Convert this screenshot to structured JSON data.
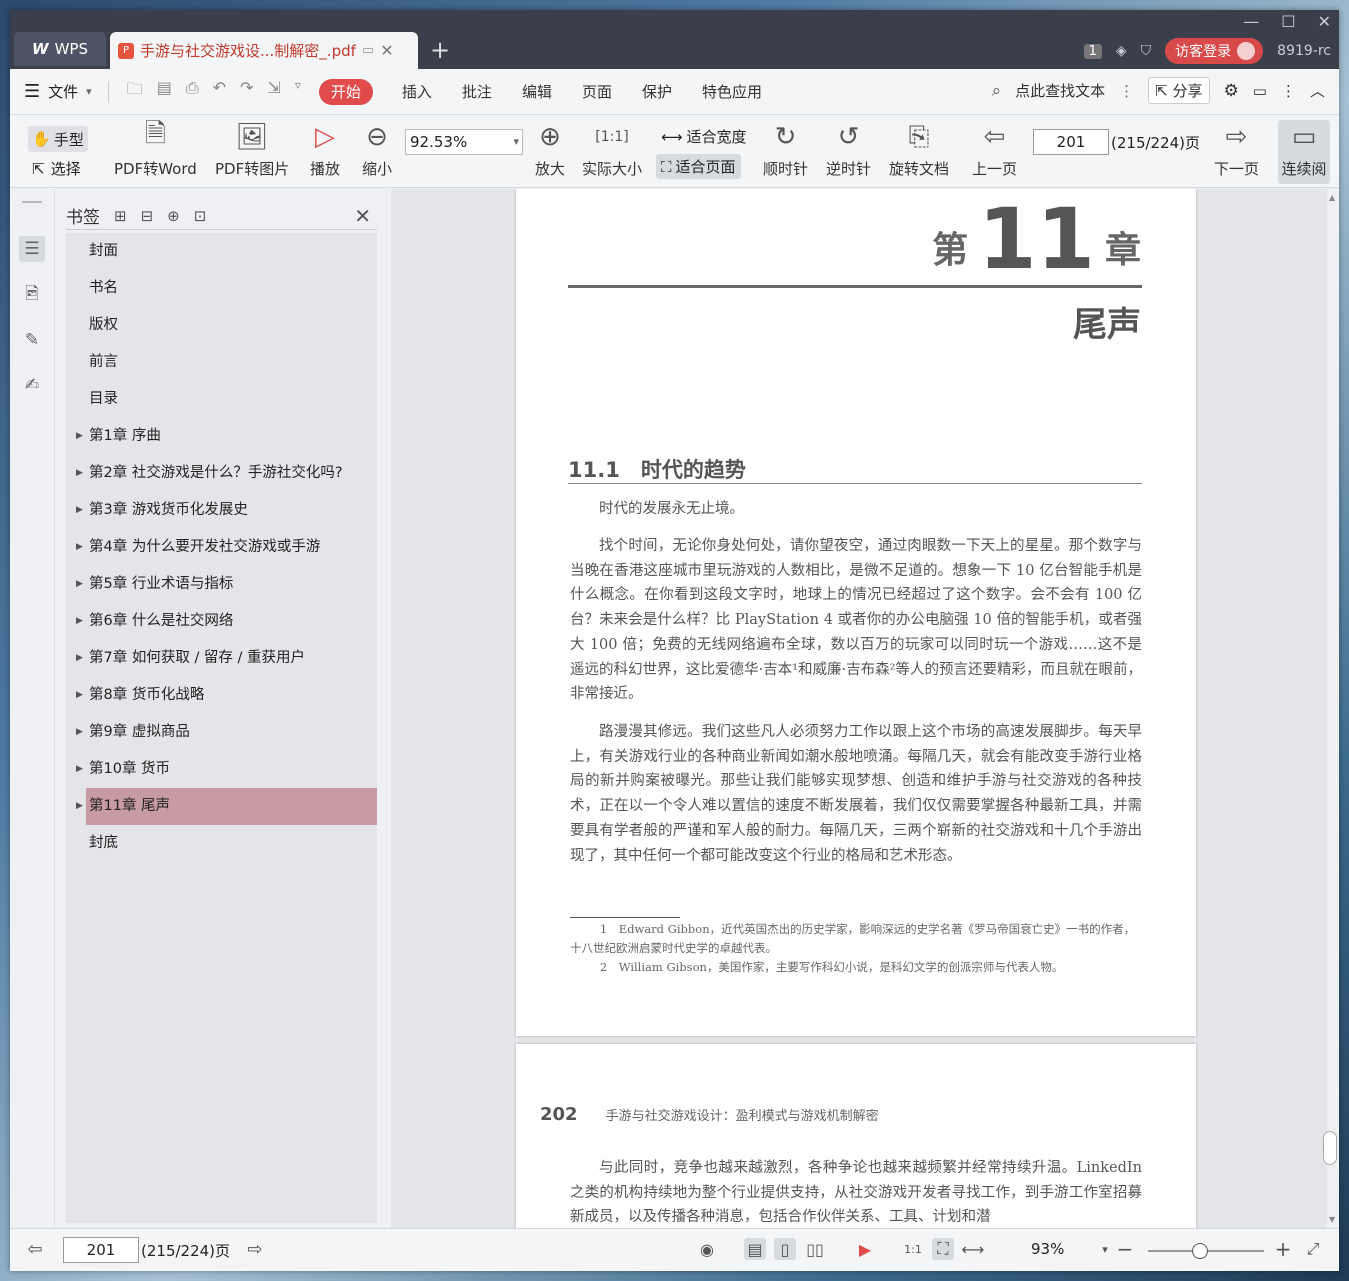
{
  "titlebar": {
    "app_tab": "WPS",
    "doc_tab": "手游与社交游戏设...制解密_.pdf",
    "page_badge": "1",
    "login_label": "访客登录",
    "user_id": "8919-rc"
  },
  "menubar": {
    "file": "文件",
    "items": [
      "开始",
      "插入",
      "批注",
      "编辑",
      "页面",
      "保护",
      "特色应用"
    ],
    "search": "点此查找文本",
    "share": "分享"
  },
  "toolbar": {
    "hand": "手型",
    "select": "选择",
    "pdf_to_word": "PDF转Word",
    "pdf_to_image": "PDF转图片",
    "play": "播放",
    "zoom_out": "缩小",
    "zoom_value": "92.53%",
    "zoom_in": "放大",
    "actual_size": "实际大小",
    "fit_width": "适合宽度",
    "fit_page": "适合页面",
    "clockwise": "顺时针",
    "counterclockwise": "逆时针",
    "rotate_doc": "旋转文档",
    "prev_page": "上一页",
    "page_input": "201",
    "page_count": "(215/224)页",
    "next_page": "下一页",
    "continuous": "连续阅"
  },
  "bookmarks": {
    "title": "书签",
    "items": [
      {
        "label": "封面",
        "expandable": false
      },
      {
        "label": "书名",
        "expandable": false
      },
      {
        "label": "版权",
        "expandable": false
      },
      {
        "label": "前言",
        "expandable": false
      },
      {
        "label": "目录",
        "expandable": false
      },
      {
        "label": "第1章 序曲",
        "expandable": true
      },
      {
        "label": "第2章 社交游戏是什么？手游社交化吗?",
        "expandable": true
      },
      {
        "label": "第3章 游戏货币化发展史",
        "expandable": true
      },
      {
        "label": "第4章 为什么要开发社交游戏或手游",
        "expandable": true
      },
      {
        "label": "第5章 行业术语与指标",
        "expandable": true
      },
      {
        "label": "第6章 什么是社交网络",
        "expandable": true
      },
      {
        "label": "第7章 如何获取 / 留存 / 重获用户",
        "expandable": true
      },
      {
        "label": "第8章 货币化战略",
        "expandable": true
      },
      {
        "label": "第9章 虚拟商品",
        "expandable": true
      },
      {
        "label": "第10章 货币",
        "expandable": true
      },
      {
        "label": "第11章 尾声",
        "expandable": true,
        "selected": true
      },
      {
        "label": "封底",
        "expandable": false
      }
    ]
  },
  "page1": {
    "chapter_prefix": "第",
    "chapter_num": "11",
    "chapter_suffix": "章",
    "chapter_title": "尾声",
    "section": "11.1　时代的趋势",
    "p1": "时代的发展永无止境。",
    "p2": "找个时间，无论你身处何处，请你望夜空，通过肉眼数一下天上的星星。那个数字与当晚在香港这座城市里玩游戏的人数相比，是微不足道的。想象一下 10 亿台智能手机是什么概念。在你看到这段文字时，地球上的情况已经超过了这个数字。会不会有 100 亿台？未来会是什么样？比 PlayStation 4 或者你的办公电脑强 10 倍的智能手机，或者强大 100 倍；免费的无线网络遍布全球，数以百万的玩家可以同时玩一个游戏……这不是遥远的科幻世界，这比爱德华·吉本¹和威廉·吉布森²等人的预言还要精彩，而且就在眼前，非常接近。",
    "p3": "路漫漫其修远。我们这些凡人必须努力工作以跟上这个市场的高速发展脚步。每天早上，有关游戏行业的各种商业新闻如潮水般地喷涌。每隔几天，就会有能改变手游行业格局的新并购案被曝光。那些让我们能够实现梦想、创造和维护手游与社交游戏的各种技术，正在以一个令人难以置信的速度不断发展着，我们仅仅需要掌握各种最新工具，并需要具有学者般的严谨和军人般的耐力。每隔几天，三两个崭新的社交游戏和十几个手游出现了，其中任何一个都可能改变这个行业的格局和艺术形态。",
    "fn1": "1　Edward Gibbon，近代英国杰出的历史学家，影响深远的史学名著《罗马帝国衰亡史》一书的作者，十八世纪欧洲启蒙时代史学的卓越代表。",
    "fn2": "2　William Gibson，美国作家，主要写作科幻小说，是科幻文学的创派宗师与代表人物。"
  },
  "page2": {
    "page_num": "202",
    "running_title": "手游与社交游戏设计：盈利模式与游戏机制解密",
    "p1": "与此同时，竞争也越来越激烈，各种争论也越来越频繁并经常持续升温。LinkedIn 之类的机构持续地为整个行业提供支持，从社交游戏开发者寻找工作，到手游工作室招募新成员，以及传播各种消息，包括合作伙伴关系、工具、计划和潜"
  },
  "statusbar": {
    "page_input": "201",
    "page_count": "(215/224)页",
    "zoom": "93%",
    "zoom_level_percent": 93
  }
}
